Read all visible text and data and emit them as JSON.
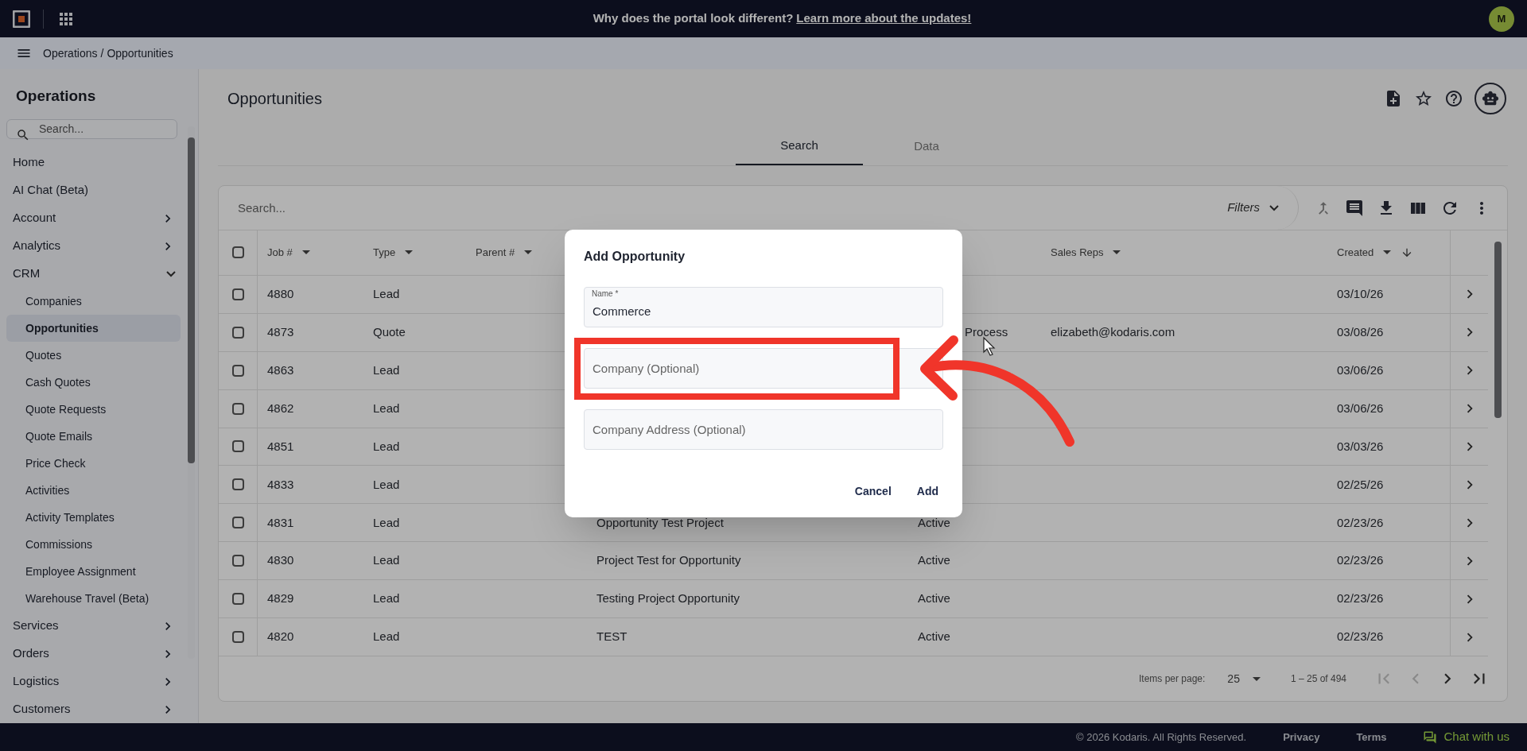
{
  "banner": {
    "text": "Why does the portal look different?",
    "link": "Learn more about the updates!"
  },
  "user": {
    "initial": "M"
  },
  "breadcrumb": {
    "items": [
      "Operations",
      "Opportunities"
    ],
    "separator": "/"
  },
  "sidebar": {
    "title": "Operations",
    "search_placeholder": "Search...",
    "items": [
      {
        "label": "Home",
        "kind": "link"
      },
      {
        "label": "AI Chat (Beta)",
        "kind": "link"
      },
      {
        "label": "Account",
        "kind": "group",
        "expanded": false
      },
      {
        "label": "Analytics",
        "kind": "group",
        "expanded": false
      },
      {
        "label": "CRM",
        "kind": "group",
        "expanded": true,
        "children": [
          {
            "label": "Companies",
            "selected": false
          },
          {
            "label": "Opportunities",
            "selected": true
          },
          {
            "label": "Quotes",
            "selected": false
          },
          {
            "label": "Cash Quotes",
            "selected": false
          },
          {
            "label": "Quote Requests",
            "selected": false
          },
          {
            "label": "Quote Emails",
            "selected": false
          },
          {
            "label": "Price Check",
            "selected": false
          },
          {
            "label": "Activities",
            "selected": false
          },
          {
            "label": "Activity Templates",
            "selected": false
          },
          {
            "label": "Commissions",
            "selected": false
          },
          {
            "label": "Employee Assignment",
            "selected": false
          },
          {
            "label": "Warehouse Travel (Beta)",
            "selected": false
          }
        ]
      },
      {
        "label": "Services",
        "kind": "group",
        "expanded": false
      },
      {
        "label": "Orders",
        "kind": "group",
        "expanded": false
      },
      {
        "label": "Logistics",
        "kind": "group",
        "expanded": false
      },
      {
        "label": "Customers",
        "kind": "group",
        "expanded": false
      }
    ]
  },
  "page": {
    "title": "Opportunities",
    "tabs": [
      {
        "label": "Search",
        "selected": true
      },
      {
        "label": "Data",
        "selected": false
      }
    ]
  },
  "table": {
    "search_placeholder": "Search...",
    "filters": "Filters",
    "all_checked": false,
    "columns": [
      {
        "label": "Job #",
        "sorted": false
      },
      {
        "label": "Type",
        "sorted": false
      },
      {
        "label": "Parent #",
        "sorted": false
      },
      null,
      null,
      {
        "label": "Sales Reps",
        "sorted": false
      },
      {
        "label": "Created",
        "sorted": true
      }
    ],
    "rows": [
      {
        "checked": false,
        "cells": [
          "4880",
          "Lead",
          null,
          null,
          null,
          null,
          "03/10/26"
        ]
      },
      {
        "checked": false,
        "cells": [
          "4873",
          "Quote",
          null,
          null,
          {
            "text": "Process",
            "clipped": true
          },
          "elizabeth@kodaris.com",
          "03/08/26"
        ]
      },
      {
        "checked": false,
        "cells": [
          "4863",
          "Lead",
          null,
          null,
          null,
          null,
          "03/06/26"
        ]
      },
      {
        "checked": false,
        "cells": [
          "4862",
          "Lead",
          null,
          null,
          null,
          null,
          "03/06/26"
        ]
      },
      {
        "checked": false,
        "cells": [
          "4851",
          "Lead",
          null,
          null,
          null,
          null,
          "03/03/26"
        ]
      },
      {
        "checked": false,
        "cells": [
          "4833",
          "Lead",
          null,
          null,
          null,
          null,
          "02/25/26"
        ]
      },
      {
        "checked": false,
        "cells": [
          "4831",
          "Lead",
          null,
          "Opportunity Test Project",
          "Active",
          null,
          "02/23/26"
        ]
      },
      {
        "checked": false,
        "cells": [
          "4830",
          "Lead",
          null,
          "Project Test for Opportunity",
          "Active",
          null,
          "02/23/26"
        ]
      },
      {
        "checked": false,
        "cells": [
          "4829",
          "Lead",
          null,
          "Testing Project Opportunity",
          "Active",
          null,
          "02/23/26"
        ]
      },
      {
        "checked": false,
        "cells": [
          "4820",
          "Lead",
          null,
          "TEST",
          "Active",
          null,
          "02/23/26"
        ]
      }
    ],
    "pagination": {
      "label": "Items per page:",
      "page_size": "25",
      "range": "1 – 25 of 494",
      "buttons": [
        {
          "kind": "first",
          "disabled": true
        },
        {
          "kind": "prev",
          "disabled": true
        },
        {
          "kind": "next",
          "disabled": false
        },
        {
          "kind": "last",
          "disabled": false
        }
      ]
    }
  },
  "dialog": {
    "title": "Add Opportunity",
    "fields": [
      {
        "label": "Name *",
        "value": "Commerce"
      },
      {
        "placeholder": "Company (Optional)"
      },
      {
        "placeholder": "Company Address (Optional)"
      }
    ],
    "buttons": [
      "Cancel",
      "Add"
    ]
  },
  "footer": {
    "copyright": "© 2026 Kodaris. All Rights Reserved.",
    "links": [
      "Privacy",
      "Terms"
    ],
    "chat": "Chat with us"
  }
}
